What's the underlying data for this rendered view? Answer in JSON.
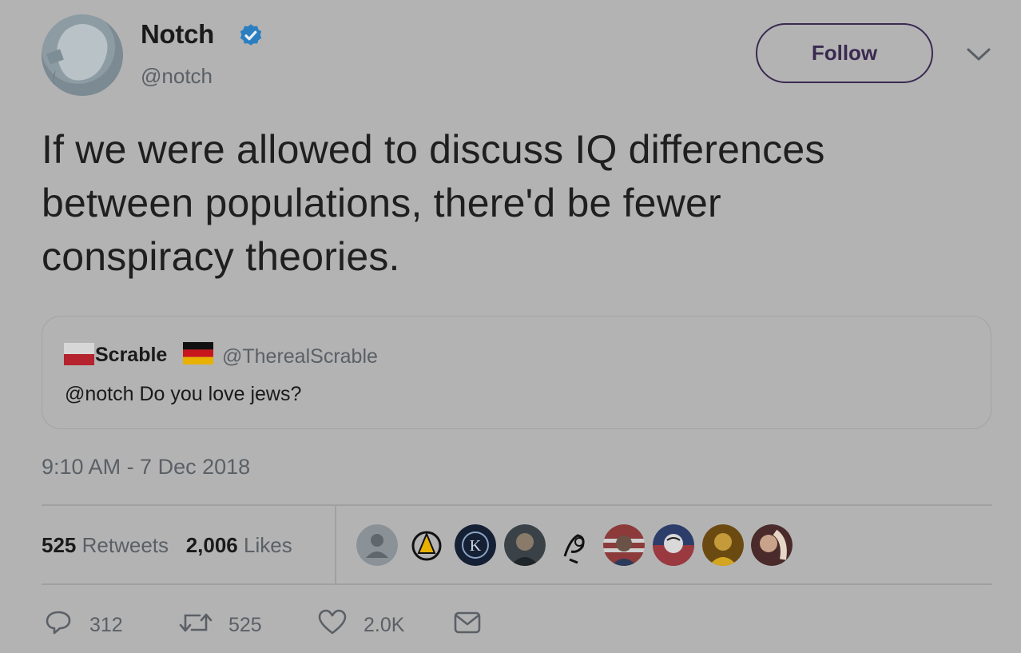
{
  "author": {
    "name": "Notch",
    "handle": "@notch",
    "verified_icon": "verified-badge-icon",
    "accent": "#1da1f2"
  },
  "follow_button": {
    "label": "Follow"
  },
  "menu": {
    "icon": "chevron-down-icon"
  },
  "tweet": {
    "line1": "If we were allowed to discuss IQ differences",
    "line2": "between populations, there'd be fewer",
    "line3": "conspiracy theories."
  },
  "quoted": {
    "name": "Scrable",
    "handle": "@TherealScrable",
    "text": "@notch Do you love jews?",
    "flags": [
      "flag-poland-icon",
      "flag-germany-icon"
    ]
  },
  "timestamp": "9:10 AM - 7 Dec 2018",
  "stats": {
    "retweets_count": "525",
    "retweets_label": "Retweets",
    "likes_count": "2,006",
    "likes_label": "Likes"
  },
  "likers": [
    "avatar-1",
    "avatar-2",
    "avatar-3",
    "avatar-4",
    "avatar-5",
    "avatar-6",
    "avatar-7",
    "avatar-8",
    "avatar-9"
  ],
  "actions": {
    "reply_count": "312",
    "retweet_count": "525",
    "like_count": "2.0K"
  }
}
